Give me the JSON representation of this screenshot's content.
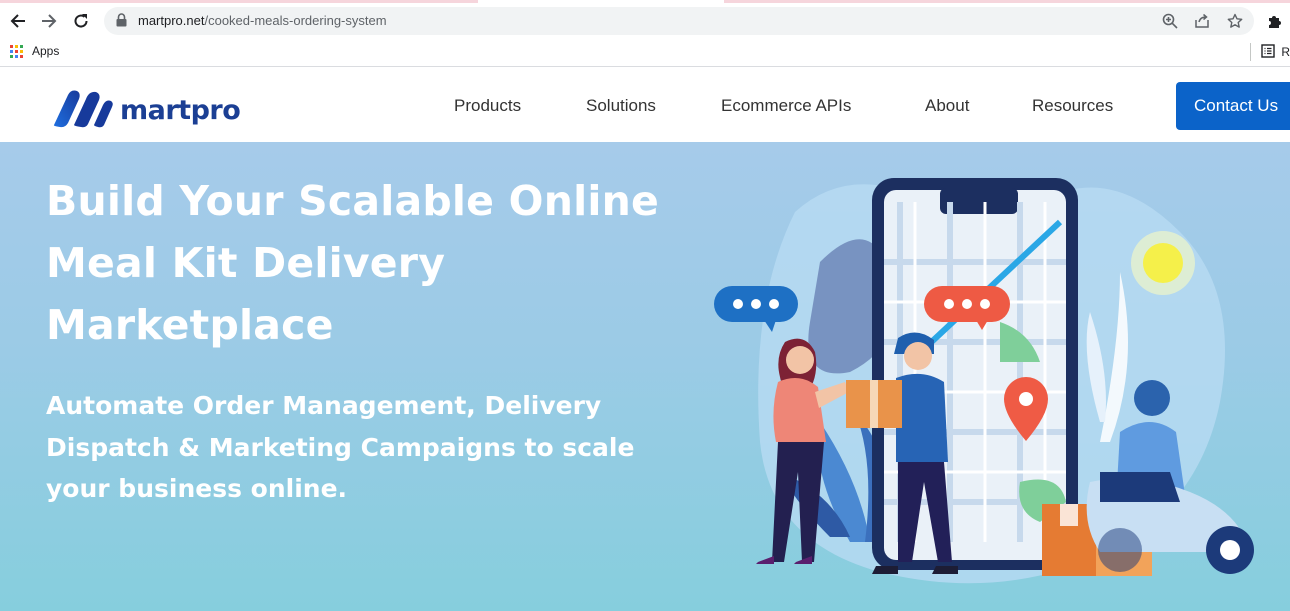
{
  "browser": {
    "url_domain": "martpro.net",
    "url_path": "/cooked-meals-ordering-system",
    "bookmarks": {
      "apps_label": "Apps",
      "right_label": "R"
    },
    "icons": [
      "back-arrow-icon",
      "forward-arrow-icon",
      "reload-icon",
      "lock-icon",
      "zoom-icon",
      "share-icon",
      "star-icon",
      "extensions-puzzle-icon",
      "apps-grid-icon",
      "reading-list-icon"
    ]
  },
  "site": {
    "brand": "martpro",
    "nav": {
      "items": [
        {
          "label": "Products"
        },
        {
          "label": "Solutions"
        },
        {
          "label": "Ecommerce APIs"
        },
        {
          "label": "About"
        },
        {
          "label": "Resources"
        }
      ],
      "cta": "Contact Us"
    },
    "hero": {
      "title_lines": [
        "Build Your Scalable Online",
        "Meal Kit Delivery",
        "Marketplace"
      ],
      "subtitle_lines": [
        "Automate Order Management, Delivery",
        "Dispatch & Marketing Campaigns to scale",
        "your business online."
      ]
    }
  },
  "colors": {
    "brand_blue": "#1b3f94",
    "cta_blue": "#0b63c9",
    "hero_top": "#a6cbea",
    "hero_bottom": "#86cedd"
  }
}
